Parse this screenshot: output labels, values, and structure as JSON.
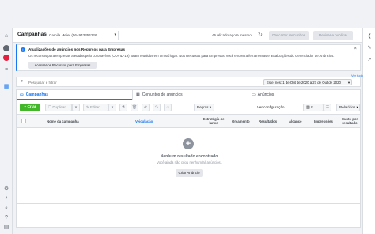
{
  "header": {
    "title": "Campanhas",
    "account": "Camila Meier (564943354226...",
    "updated_text": "Atualizado agora mesmo",
    "discard_label": "Descartar rascunhos",
    "review_label": "Revisar e publicar"
  },
  "notice": {
    "title": "Atualizações de anúncios nos Recursos para Empresas",
    "body": "Os recursos para empresas afetadas pelo coronavírus (COVID-19) foram reunidos em um só lugar. Nos Recursos para Empresas, você encontra ferramentas e atualizações do Gerenciador de Anúncios.",
    "button_label": "Acessar os Recursos para Empresas",
    "view_more": "Ver tudo"
  },
  "search": {
    "placeholder": "Pesquisar e filtrar",
    "date_range": "Este mês: 1 de Out de 2020 a 27 de Out de 2020"
  },
  "tabs": [
    {
      "label": "Campanhas"
    },
    {
      "label": "Conjuntos de anúncios"
    },
    {
      "label": "Anúncios"
    }
  ],
  "toolbar": {
    "create_label": "Criar",
    "duplicate_label": "Duplicar",
    "edit_label": "Editar",
    "rules_label": "Regras",
    "view_config": "Ver configuração",
    "reports_label": "Relatórios"
  },
  "table": {
    "columns": [
      "Nome da campanha",
      "Veiculação",
      "Estratégia de lance",
      "Orçamento",
      "Resultados",
      "Alcance",
      "Impressões",
      "Custo por resultado"
    ]
  },
  "empty": {
    "title": "Nenhum resultado encontrado",
    "subtitle": "Você ainda não criou nenhum(a) anúncios.",
    "button_label": "Criar Anúncio"
  },
  "colors": {
    "accent": "#1877f2",
    "create": "#42b72a"
  }
}
